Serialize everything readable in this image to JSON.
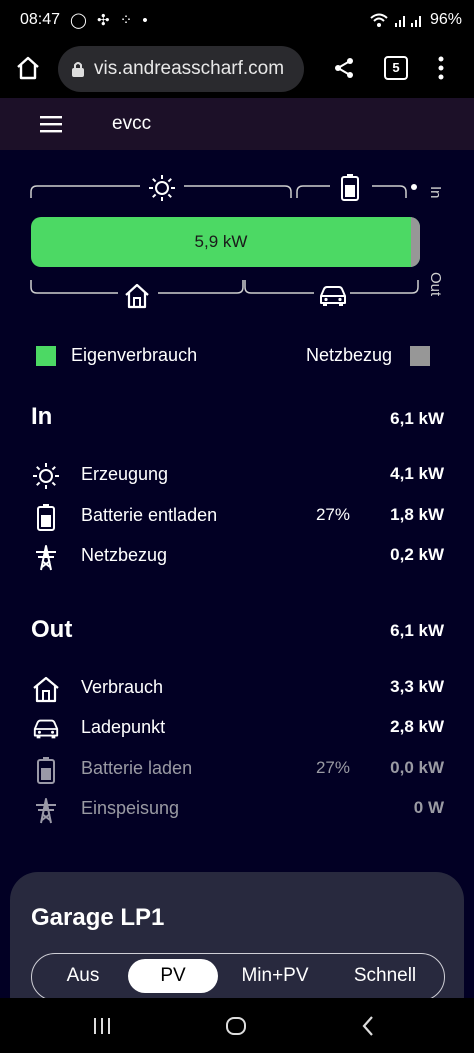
{
  "status_bar": {
    "time": "08:47",
    "notif_icons": "◯ ✣ ⁘ •",
    "battery": "96%"
  },
  "browser": {
    "url": "vis.andreasscharf.com",
    "tab_count": "5"
  },
  "app": {
    "title": "evcc"
  },
  "visualization": {
    "bar_label": "5,9 kW",
    "in_label": "In",
    "out_label": "Out",
    "green_fraction": 0.977,
    "colors": {
      "self": "#4cd964",
      "grid": "#979797"
    }
  },
  "legend": {
    "self_label": "Eigenverbrauch",
    "grid_label": "Netzbezug"
  },
  "in": {
    "title": "In",
    "total": "6,1 kW",
    "rows": [
      {
        "label": "Erzeugung",
        "percent": "",
        "value": "4,1 kW",
        "icon": "sun-icon"
      },
      {
        "label": "Batterie entladen",
        "percent": "27%",
        "value": "1,8 kW",
        "icon": "battery-icon"
      },
      {
        "label": "Netzbezug",
        "percent": "",
        "value": "0,2 kW",
        "icon": "power-tower-icon"
      }
    ]
  },
  "out": {
    "title": "Out",
    "total": "6,1 kW",
    "rows": [
      {
        "label": "Verbrauch",
        "percent": "",
        "value": "3,3 kW",
        "icon": "home-icon"
      },
      {
        "label": "Ladepunkt",
        "percent": "",
        "value": "2,8 kW",
        "icon": "car-icon"
      },
      {
        "label": "Batterie laden",
        "percent": "27%",
        "value": "0,0 kW",
        "icon": "battery-icon"
      },
      {
        "label": "Einspeisung",
        "percent": "",
        "value": "0 W",
        "icon": "power-tower-icon"
      }
    ]
  },
  "loadpoint": {
    "title": "Garage LP1",
    "modes": [
      "Aus",
      "PV",
      "Min+PV",
      "Schnell"
    ],
    "active_mode": "PV"
  }
}
